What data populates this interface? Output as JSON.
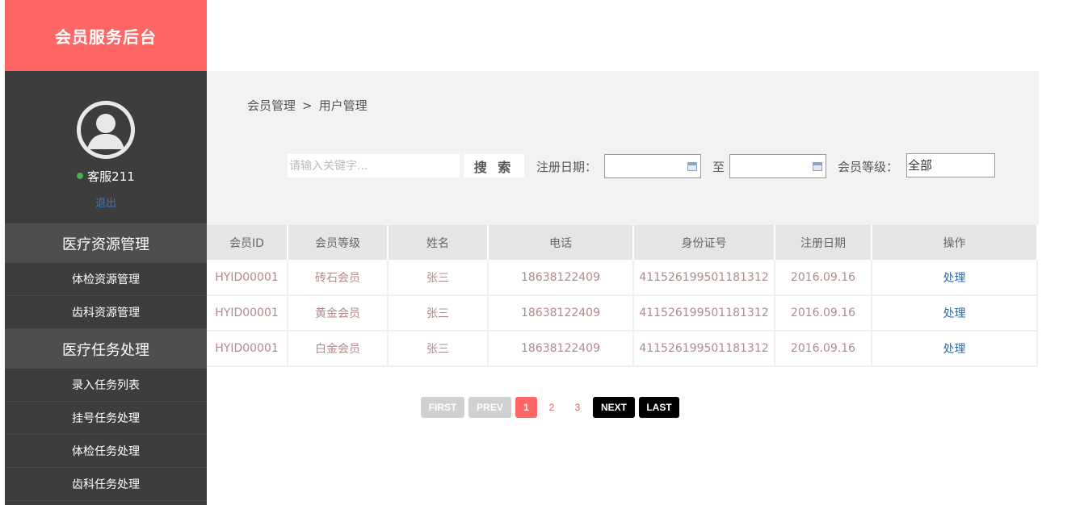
{
  "sidebar": {
    "brand": "会员服务后台",
    "username": "客服211",
    "logout": "退出",
    "groups": [
      {
        "title": "医疗资源管理",
        "items": [
          "体检资源管理",
          "齿科资源管理"
        ]
      },
      {
        "title": "医疗任务处理",
        "items": [
          "录入任务列表",
          "挂号任务处理",
          "体检任务处理",
          "齿科任务处理"
        ]
      }
    ]
  },
  "breadcrumb": {
    "parent": "会员管理",
    "separator": ">",
    "current": "用户管理"
  },
  "search": {
    "placeholder": "请输入关键字...",
    "button": "搜 索",
    "date_label": "注册日期：",
    "to_label": "至",
    "level_label": "会员等级：",
    "level_value": "全部"
  },
  "table": {
    "headers": [
      "会员ID",
      "会员等级",
      "姓名",
      "电话",
      "身份证号",
      "注册日期",
      "操作"
    ],
    "rows": [
      [
        "HYID00001",
        "砖石会员",
        "张三",
        "18638122409",
        "411526199501181312",
        "2016.09.16",
        "处理"
      ],
      [
        "HYID00001",
        "黄金会员",
        "张三",
        "18638122409",
        "411526199501181312",
        "2016.09.16",
        "处理"
      ],
      [
        "HYID00001",
        "白金会员",
        "张三",
        "18638122409",
        "411526199501181312",
        "2016.09.16",
        "处理"
      ]
    ]
  },
  "pagination": {
    "first": "FIRST",
    "prev": "PREV",
    "pages": [
      "1",
      "2",
      "3"
    ],
    "current": "1",
    "next": "NEXT",
    "last": "LAST"
  },
  "colors": {
    "brand": "#ff6666",
    "sidebar": "#3d3d3d",
    "link": "#2d6aa8",
    "online": "#4caf50"
  }
}
